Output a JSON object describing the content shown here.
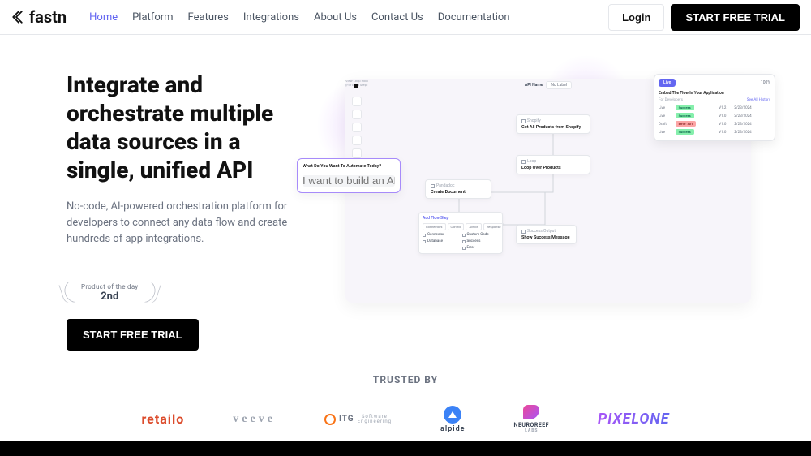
{
  "brand": "fastn",
  "nav": [
    "Home",
    "Platform",
    "Features",
    "Integrations",
    "About Us",
    "Contact Us",
    "Documentation"
  ],
  "header": {
    "login": "Login",
    "trial": "START FREE TRIAL"
  },
  "hero": {
    "title": "Integrate and orchestrate multiple data sources in a single, unified API",
    "subtitle": "No-code, AI-powered orchestration platform for developers to connect any data flow and create hundreds of app integrations.",
    "badge_label": "Product of the day",
    "badge_rank": "2nd",
    "cta": "START FREE TRIAL"
  },
  "canvas": {
    "api_name_label": "API Name",
    "no_label": "No Label",
    "live": "Live",
    "zoom": "100%",
    "nodes": {
      "shopify_hdr": "Shopify",
      "shopify_body": "Get All Products from Shopify",
      "loop_hdr": "Loop",
      "loop_body": "Loop Over Products",
      "doc_hdr": "Pandadoc",
      "doc_body": "Create Document",
      "doc_side": "View Loop Flow",
      "doc_side2": "(For Each Step)",
      "success_hdr": "Success Output",
      "success_body": "Show Success Message"
    },
    "prompt": {
      "question": "What Do You Want To Automate Today?",
      "placeholder": "I want to build an API that..."
    },
    "flow": {
      "title": "Add Flow Step",
      "tabs": [
        "Connectors",
        "Control",
        "Action",
        "Response"
      ],
      "cells": [
        "Connector",
        "Custom Code",
        "Database",
        "Success",
        "",
        "Error"
      ]
    },
    "live_panel": {
      "embed": "Embed The Flow In Your Application",
      "for_label": "For Developers",
      "history": "See All History",
      "rows": [
        {
          "kind": "Live",
          "status": "Success",
          "ver": "V1.2",
          "date": "2/23/2024"
        },
        {
          "kind": "Live",
          "status": "Success",
          "ver": "V1.0",
          "date": "2/23/2024"
        },
        {
          "kind": "Draft",
          "status": "Error: 401",
          "ver": "V1.0",
          "date": "2/23/2024"
        },
        {
          "kind": "Live",
          "status": "Success",
          "ver": "V1.0",
          "date": "2/23/2024"
        }
      ]
    }
  },
  "trusted": {
    "label": "TRUSTED BY",
    "logos": {
      "retailo": "retailo",
      "veeve": "veeve",
      "itg": "ITG",
      "itg_sub1": "Software",
      "itg_sub2": "Engineering",
      "alpide": "alpide",
      "neuro": "NEUROREEF",
      "neuro_sub": "LABS",
      "pixel": "PIXELONE"
    }
  }
}
